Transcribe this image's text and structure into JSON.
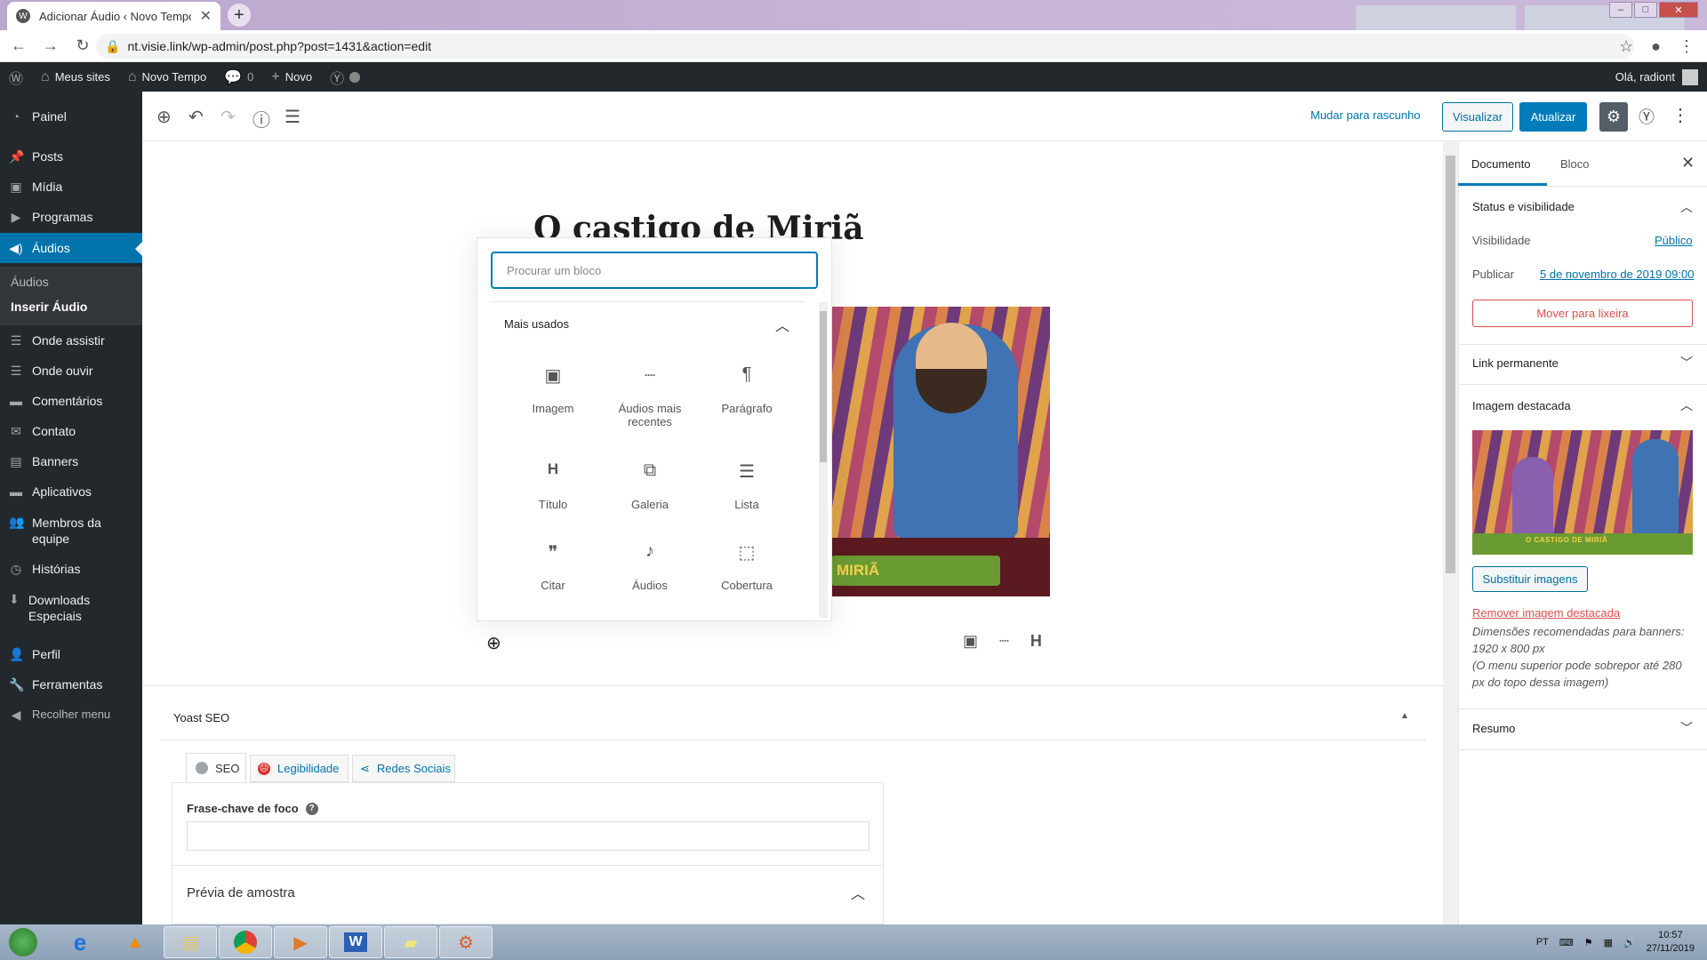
{
  "browser": {
    "tab_title": "Adicionar Áudio ‹ Novo Tempo —",
    "url": "nt.visie.link/wp-admin/post.php?post=1431&action=edit"
  },
  "adminbar": {
    "my_sites": "Meus sites",
    "site_name": "Novo Tempo",
    "comments_count": "0",
    "new_label": "Novo",
    "greeting": "Olá, radiont"
  },
  "sidebar": {
    "items": [
      {
        "label": "Painel",
        "icon": "dashboard-icon"
      },
      {
        "label": "Posts",
        "icon": "pin-icon"
      },
      {
        "label": "Mídia",
        "icon": "media-icon"
      },
      {
        "label": "Programas",
        "icon": "video-icon"
      },
      {
        "label": "Áudios",
        "icon": "speaker-icon"
      },
      {
        "label": "Onde assistir",
        "icon": "list-icon"
      },
      {
        "label": "Onde ouvir",
        "icon": "list-icon"
      },
      {
        "label": "Comentários",
        "icon": "comment-icon"
      },
      {
        "label": "Contato",
        "icon": "mail-icon"
      },
      {
        "label": "Banners",
        "icon": "folder-icon"
      },
      {
        "label": "Aplicativos",
        "icon": "comment-icon"
      },
      {
        "label": "Membros da equipe",
        "icon": "people-icon"
      },
      {
        "label": "Histórias",
        "icon": "history-icon"
      },
      {
        "label": "Downloads Especiais",
        "icon": "download-icon"
      },
      {
        "label": "Perfil",
        "icon": "user-icon"
      },
      {
        "label": "Ferramentas",
        "icon": "wrench-icon"
      },
      {
        "label": "Recolher menu",
        "icon": "collapse-icon"
      }
    ],
    "submenu": [
      "Áudios",
      "Inserir Áudio"
    ]
  },
  "editor": {
    "switch_draft": "Mudar para rascunho",
    "preview": "Visualizar",
    "update": "Atualizar",
    "post_title": "O castigo de Miriã",
    "image_banner_text": "MIRIÃ"
  },
  "inserter": {
    "search_placeholder": "Procurar um bloco",
    "section_title": "Mais usados",
    "blocks": [
      {
        "label": "Imagem",
        "icon": "image-icon"
      },
      {
        "label": "Áudios mais recentes",
        "icon": "separator-icon"
      },
      {
        "label": "Parágrafo",
        "icon": "paragraph-icon"
      },
      {
        "label": "Título",
        "icon": "heading-icon"
      },
      {
        "label": "Galeria",
        "icon": "gallery-icon"
      },
      {
        "label": "Lista",
        "icon": "list-icon"
      },
      {
        "label": "Citar",
        "icon": "quote-icon"
      },
      {
        "label": "Áudios",
        "icon": "music-icon"
      },
      {
        "label": "Cobertura",
        "icon": "cover-icon"
      }
    ]
  },
  "yoast": {
    "title": "Yoast SEO",
    "tabs": [
      "SEO",
      "Legibilidade",
      "Redes Sociais"
    ],
    "focus_label": "Frase-chave de foco",
    "focus_value": "",
    "preview_title": "Prévia de amostra"
  },
  "settings": {
    "tabs": [
      "Documento",
      "Bloco"
    ],
    "status_title": "Status e visibilidade",
    "visibility_label": "Visibilidade",
    "visibility_value": "Público",
    "publish_label": "Publicar",
    "publish_value": "5 de novembro de 2019 09:00",
    "trash": "Mover para lixeira",
    "permalink_title": "Link permanente",
    "featured_title": "Imagem destacada",
    "featured_image_text": "O CASTIGO DE MIRIÃ",
    "replace_button": "Substituir imagens",
    "remove_link": "Remover imagem destacada",
    "dimensions_note": "Dimensões recomendadas para banners: 1920 x 800 px",
    "overlap_note": "(O menu superior pode sobrepor até 280 px do topo dessa imagem)",
    "summary_title": "Resumo"
  },
  "taskbar": {
    "lang": "PT",
    "time": "10:57",
    "date": "27/11/2019"
  },
  "colors": {
    "wp_dark": "#23282d",
    "wp_blue": "#0073aa",
    "button_blue": "#007cba",
    "danger": "#d94f4f"
  }
}
